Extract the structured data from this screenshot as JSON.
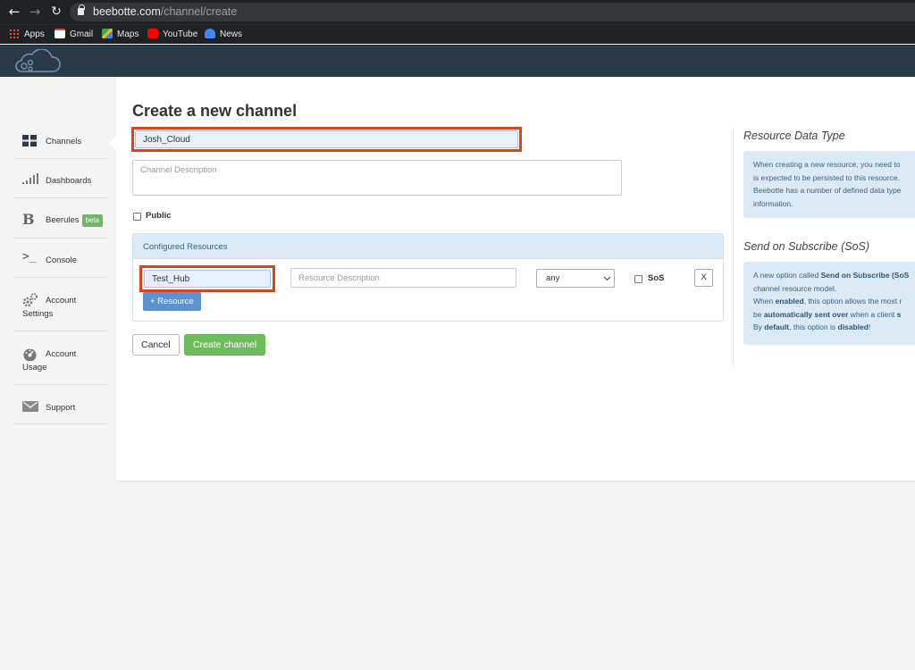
{
  "browser": {
    "url_domain": "beebotte.com",
    "url_path": "/channel/create",
    "bookmarks": [
      {
        "label": "Apps",
        "color": "#ea4335"
      },
      {
        "label": "Gmail",
        "color": "#ffffff"
      },
      {
        "label": "Maps",
        "color": "#34a853"
      },
      {
        "label": "YouTube",
        "color": "#ff0000"
      },
      {
        "label": "News",
        "color": "#4285f4"
      }
    ]
  },
  "sidebar": {
    "items": [
      {
        "label": "Channels",
        "icon": "grid-icon"
      },
      {
        "label": "Dashboards",
        "icon": "signal-bars-icon"
      },
      {
        "label": "Beerules",
        "badge": "beta",
        "icon": "b-letter-icon"
      },
      {
        "label": "Console",
        "icon": "terminal-icon"
      },
      {
        "label": "Account",
        "label2": "Settings",
        "icon": "gears-icon"
      },
      {
        "label": "Account",
        "label2": "Usage",
        "icon": "gauge-icon"
      },
      {
        "label": "Support",
        "icon": "envelope-icon"
      }
    ]
  },
  "form": {
    "title": "Create a new channel",
    "channel_name": "Josh_Cloud",
    "description_placeholder": "Channel Description",
    "public_label": "Public",
    "resources_header": "Configured Resources",
    "resource": {
      "name": "Test_Hub",
      "description_placeholder": "Resource Description",
      "type": "any",
      "sos_label": "SoS",
      "remove_label": "X"
    },
    "add_resource_label": "+ Resource",
    "cancel_label": "Cancel",
    "create_label": "Create channel"
  },
  "aside": {
    "data_type_title": "Resource Data Type",
    "data_type_lines": [
      "When creating a new resource, you need to",
      "is expected to be persisted to this resource.",
      "Beebotte has a number of defined data type",
      "information."
    ],
    "sos_title": "Send on Subscribe (SoS)",
    "sos_line1_pre": "A new option called ",
    "sos_line1_bold": "Send on Subscribe (SoS",
    "sos_line2": "channel resource model.",
    "sos_line3_pre": "When ",
    "sos_line3_bold": "enabled",
    "sos_line3_post": ", this option allows the most r",
    "sos_line4_pre": "be ",
    "sos_line4_bold": "automatically sent over",
    "sos_line4_mid": " when a client ",
    "sos_line4_bold2": "s",
    "sos_line5_pre": "By ",
    "sos_line5_bold": "default",
    "sos_line5_mid": ", this option is ",
    "sos_line5_bold2": "disabled",
    "sos_line5_post": "!"
  },
  "colors": {
    "highlight": "#d9441c",
    "create_button": "#6dbd5d",
    "add_resource_button": "#5a93cf",
    "info_box": "#dbeaf5"
  }
}
